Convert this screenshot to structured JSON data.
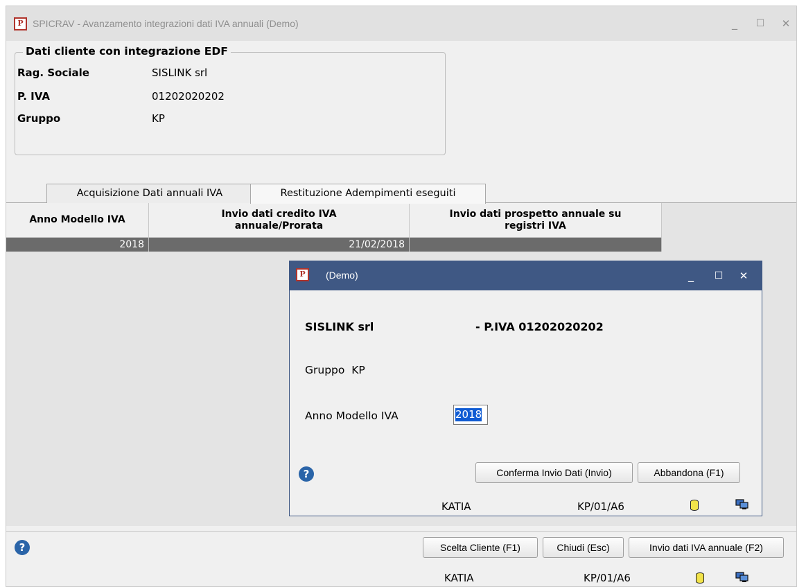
{
  "window": {
    "title": "SPICRAV - Avanzamento integrazioni dati IVA annuali  (Demo)",
    "app_icon_letter": "P",
    "controls": {
      "minimize": "_",
      "maximize": "☐",
      "close": "✕"
    }
  },
  "client_box": {
    "legend": "Dati cliente con integrazione EDF",
    "fields": [
      {
        "label": "Rag. Sociale",
        "value": "SISLINK srl"
      },
      {
        "label": "P. IVA",
        "value": "01202020202"
      },
      {
        "label": "Gruppo",
        "value": "KP"
      }
    ]
  },
  "tabs": [
    {
      "label": "Acquisizione Dati annuali IVA",
      "active": false
    },
    {
      "label": "Restituzione Adempimenti eseguiti",
      "active": true
    }
  ],
  "grid": {
    "columns": [
      {
        "header": "Anno Modello IVA"
      },
      {
        "header": "Invio dati credito IVA annuale/Prorata"
      },
      {
        "header": "Invio dati prospetto annuale su registri IVA"
      }
    ],
    "rows": [
      [
        "2018",
        "21/02/2018",
        ""
      ]
    ]
  },
  "dialog": {
    "title": "(Demo)",
    "app_icon_letter": "P",
    "client_name": "SISLINK srl",
    "piva_text": "- P.IVA 01202020202",
    "gruppo_text": "Gruppo  KP",
    "anno_label": "Anno Modello IVA",
    "anno_value": "2018",
    "confirm_button": "Conferma Invio Dati (Invio)",
    "abandon_button": "Abbandona (F1)",
    "help_symbol": "?",
    "status_user": "KATIA",
    "status_code": "KP/01/A6",
    "controls": {
      "minimize": "_",
      "maximize": "☐",
      "close": "✕"
    }
  },
  "footer": {
    "help_symbol": "?",
    "buttons": {
      "scelta_cliente": "Scelta Cliente (F1)",
      "chiudi": "Chiudi (Esc)",
      "invio_dati": "Invio dati IVA annuale (F2)"
    },
    "status_user": "KATIA",
    "status_code": "KP/01/A6"
  },
  "colors": {
    "dialog_title_bg": "#3f5884",
    "grid_selected_row": "#6b6b6b",
    "selection_highlight": "#0f5bd3",
    "help_icon": "#2a64a8",
    "app_icon_red": "#b0342c"
  },
  "icons": [
    "app-logo-icon",
    "help-icon",
    "database-icon",
    "network-computers-icon"
  ]
}
